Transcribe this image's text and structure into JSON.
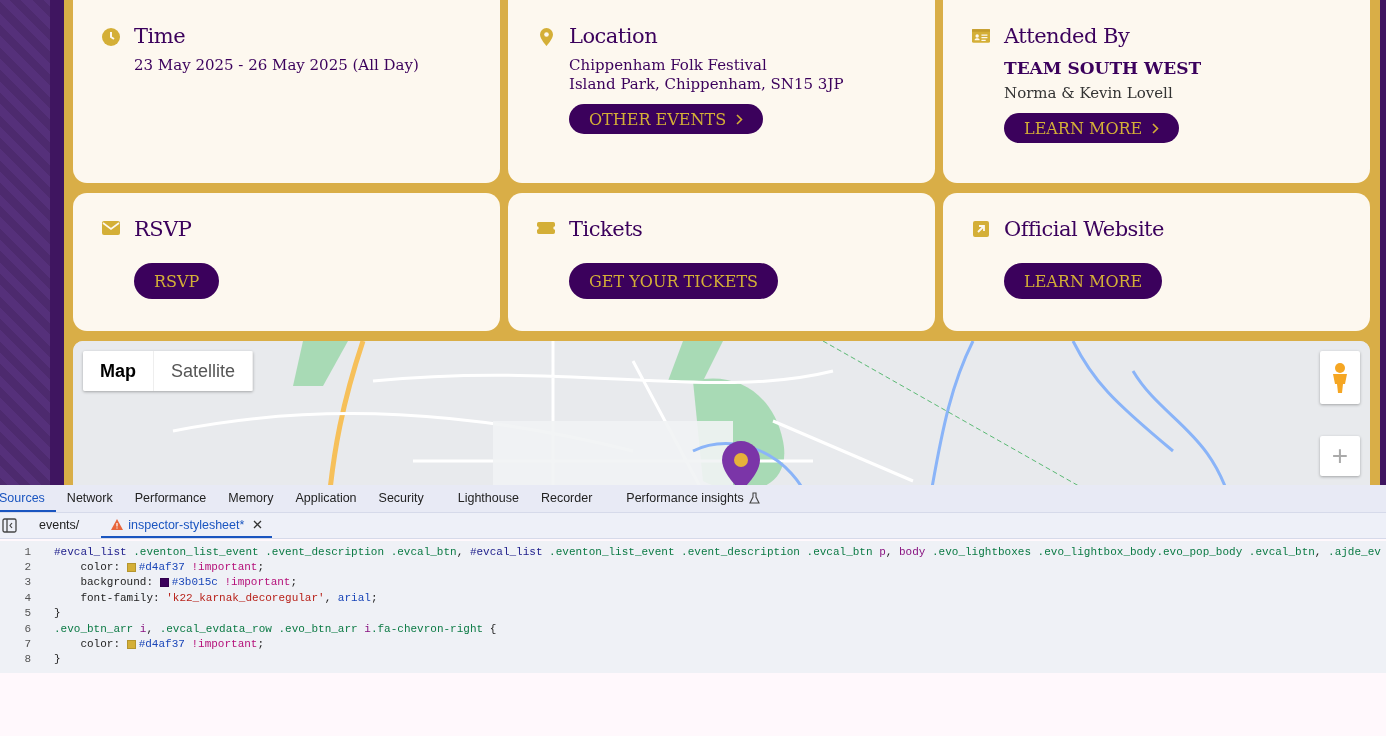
{
  "cards": [
    {
      "kind": "time",
      "title": "Time",
      "lines": [
        {
          "kind": "detail",
          "text": "23 May 2025 - 26 May 2025 (All Day)"
        }
      ]
    },
    {
      "kind": "location",
      "title": "Location",
      "lines": [
        {
          "kind": "detail",
          "text": "Chippenham Folk Festival"
        },
        {
          "kind": "detail",
          "text": "Island Park, Chippenham, SN15 3JP"
        }
      ],
      "button": {
        "label": "OTHER EVENTS",
        "arrow": true
      }
    },
    {
      "kind": "organizer",
      "title": "Attended By",
      "lines": [
        {
          "kind": "name",
          "text": "TEAM SOUTH WEST"
        },
        {
          "kind": "contact",
          "text": "Norma & Kevin Lovell"
        }
      ],
      "button": {
        "label": "LEARN MORE",
        "arrow": true
      }
    },
    {
      "kind": "rsvp",
      "title": "RSVP",
      "button": {
        "label": "RSVP",
        "arrow": false
      }
    },
    {
      "kind": "tickets",
      "title": "Tickets",
      "button": {
        "label": "GET YOUR TICKETS",
        "arrow": false
      }
    },
    {
      "kind": "website",
      "title": "Official Website",
      "button": {
        "label": "LEARN MORE",
        "arrow": false
      }
    }
  ],
  "map": {
    "type_buttons": [
      {
        "label": "Map",
        "selected": true
      },
      {
        "label": "Satellite",
        "selected": false
      }
    ],
    "zoom_in": "+"
  },
  "devtools": {
    "panel_tabs": [
      {
        "label": "Sources",
        "selected": true
      },
      {
        "label": "Network",
        "selected": false
      },
      {
        "label": "Performance",
        "selected": false
      },
      {
        "label": "Memory",
        "selected": false
      },
      {
        "label": "Application",
        "selected": false
      },
      {
        "label": "Security",
        "selected": false
      },
      {
        "label": "Lighthouse",
        "selected": false
      },
      {
        "label": "Recorder",
        "selected": false
      },
      {
        "label": "Performance insights",
        "selected": false,
        "experimental": true
      }
    ],
    "file_tabs": [
      {
        "label": "events/",
        "selected": false,
        "warning": false,
        "closable": false
      },
      {
        "label": "inspector-stylesheet*",
        "selected": true,
        "warning": true,
        "closable": true
      }
    ],
    "code_lines": [
      {
        "number": "1",
        "tokens": [
          {
            "kind": "id",
            "text": "#evcal_list "
          },
          {
            "kind": "class",
            "text": ".eventon_list_event .event_description .evcal_btn"
          },
          {
            "kind": "plain",
            "text": ", "
          },
          {
            "kind": "id",
            "text": "#evcal_list "
          },
          {
            "kind": "class",
            "text": ".eventon_list_event .event_description .evcal_btn "
          },
          {
            "kind": "tag",
            "text": "p"
          },
          {
            "kind": "plain",
            "text": ", "
          },
          {
            "kind": "tag",
            "text": "body "
          },
          {
            "kind": "class",
            "text": ".evo_lightboxes .evo_lightbox_body.evo_pop_body .evcal_btn"
          },
          {
            "kind": "plain",
            "text": ", "
          },
          {
            "kind": "class",
            "text": ".ajde_ev"
          }
        ]
      },
      {
        "number": "2",
        "tokens": [
          {
            "kind": "plain",
            "text": "    color: "
          },
          {
            "kind": "swatch",
            "color": "#d4af37"
          },
          {
            "kind": "value",
            "text": "#d4af37 "
          },
          {
            "kind": "important",
            "text": "!important"
          },
          {
            "kind": "plain",
            "text": ";"
          }
        ]
      },
      {
        "number": "3",
        "tokens": [
          {
            "kind": "plain",
            "text": "    background: "
          },
          {
            "kind": "swatch",
            "color": "#3b015c"
          },
          {
            "kind": "value",
            "text": "#3b015c "
          },
          {
            "kind": "important",
            "text": "!important"
          },
          {
            "kind": "plain",
            "text": ";"
          }
        ]
      },
      {
        "number": "4",
        "tokens": [
          {
            "kind": "plain",
            "text": "    font-family: "
          },
          {
            "kind": "string",
            "text": "'k22_karnak_decoregular'"
          },
          {
            "kind": "plain",
            "text": ", "
          },
          {
            "kind": "value",
            "text": "arial"
          },
          {
            "kind": "plain",
            "text": ";"
          }
        ]
      },
      {
        "number": "5",
        "tokens": [
          {
            "kind": "plain",
            "text": "}"
          }
        ]
      },
      {
        "number": "6",
        "tokens": [
          {
            "kind": "class",
            "text": ".evo_btn_arr "
          },
          {
            "kind": "tag",
            "text": "i"
          },
          {
            "kind": "plain",
            "text": ", "
          },
          {
            "kind": "class",
            "text": ".evcal_evdata_row .evo_btn_arr "
          },
          {
            "kind": "tag",
            "text": "i"
          },
          {
            "kind": "class",
            "text": ".fa-chevron-right"
          },
          {
            "kind": "plain",
            "text": " {"
          }
        ]
      },
      {
        "number": "7",
        "tokens": [
          {
            "kind": "plain",
            "text": "    color: "
          },
          {
            "kind": "swatch",
            "color": "#d4af37"
          },
          {
            "kind": "value",
            "text": "#d4af37 "
          },
          {
            "kind": "important",
            "text": "!important"
          },
          {
            "kind": "plain",
            "text": ";"
          }
        ]
      },
      {
        "number": "8",
        "tokens": [
          {
            "kind": "plain",
            "text": "}"
          }
        ]
      }
    ]
  }
}
